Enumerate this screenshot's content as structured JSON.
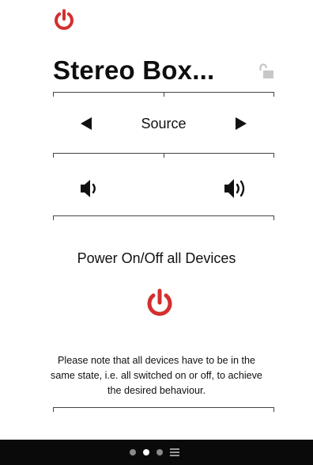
{
  "colors": {
    "power_red": "#d32f2f",
    "bottom_bar": "#0a0a0a",
    "text": "#111111"
  },
  "header": {
    "power_icon": "power-icon"
  },
  "device": {
    "title": "Stereo Box...",
    "lock_icon": "unlocked-padlock-icon"
  },
  "source": {
    "label": "Source",
    "prev_icon": "triangle-left-icon",
    "next_icon": "triangle-right-icon"
  },
  "volume": {
    "down_icon": "volume-down-icon",
    "up_icon": "volume-up-icon"
  },
  "power_all": {
    "label": "Power On/Off all Devices",
    "icon": "power-icon"
  },
  "note": {
    "text": "Please note that all devices have to be in the same state, i.e. all switched on or off, to achieve the desired behaviour."
  },
  "pager": {
    "pages": 3,
    "current_page": 2,
    "menu_icon": "hamburger-menu-icon"
  }
}
